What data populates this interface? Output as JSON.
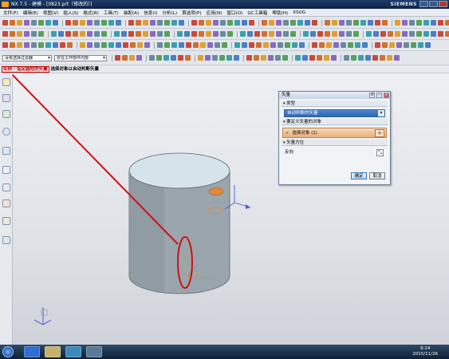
{
  "window": {
    "title": "NX 7.5 - 建模 - [0823.prt（修改的）]",
    "brand": "SIEMENS"
  },
  "menubar": {
    "items": [
      "文件(F)",
      "编辑(E)",
      "视图(V)",
      "插入(S)",
      "格式(R)",
      "工具(T)",
      "装配(A)",
      "信息(I)",
      "分析(L)",
      "首选项(P)",
      "应用(N)",
      "窗口(O)",
      "GC工具箱",
      "帮助(H)",
      "XSUG"
    ]
  },
  "selection_bar": {
    "filter": "没有选择过滤器",
    "scope": "仅在工作部件内部"
  },
  "cue_line": {
    "hint": "实例 - 指定圆柱的矢量",
    "prompt": "选择对象以自动判断矢量"
  },
  "dialog": {
    "title": "矢量",
    "type_section": "类型",
    "type_value": "自动判断的矢量",
    "object_section": "要定义矢量的对象",
    "select_object_label": "选择对象 (1)",
    "orientation_section": "矢量方位",
    "reverse_label": "反向",
    "ok_label": "确定",
    "cancel_label": "取消"
  },
  "taskbar": {
    "time": "9:14",
    "date": "2015/11/26"
  },
  "colors": {
    "accent": "#3465a8",
    "annotation": "#d01010",
    "cylinder": "#9aa4ac",
    "cylinder_top": "#d8e6ec",
    "selection": "#e8b07a"
  }
}
